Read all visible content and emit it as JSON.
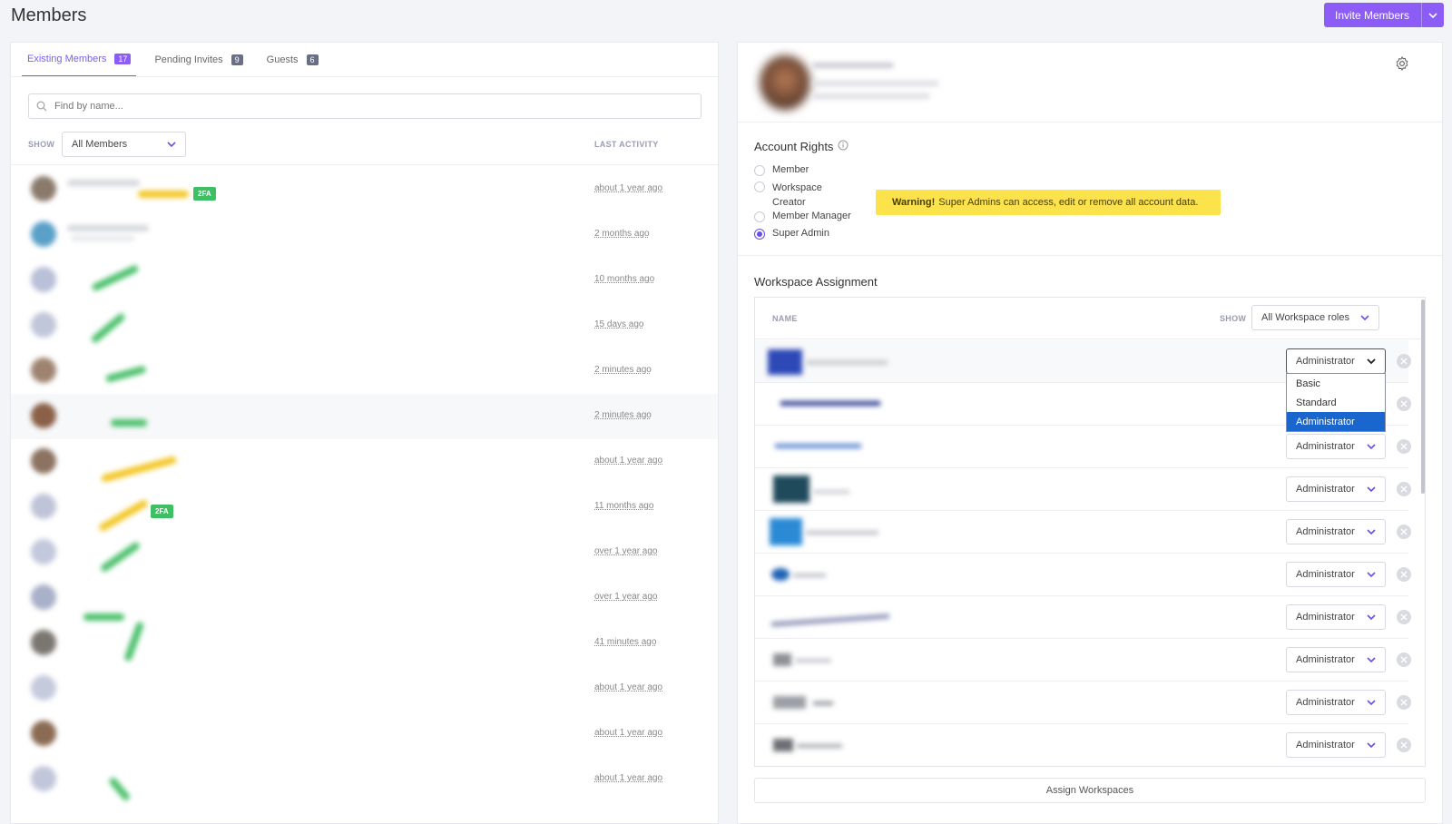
{
  "header": {
    "title": "Members",
    "invite_label": "Invite Members",
    "accent": "#8b5cf6"
  },
  "members_panel": {
    "tabs": [
      {
        "label": "Existing Members",
        "count": "17"
      },
      {
        "label": "Pending Invites",
        "count": "9"
      },
      {
        "label": "Guests",
        "count": "6"
      }
    ],
    "search_placeholder": "Find by name...",
    "show_label": "SHOW",
    "show_value": "All Members",
    "last_activity_label": "LAST ACTIVITY",
    "members": [
      {
        "activity": "about 1 year ago",
        "badge": "2FA"
      },
      {
        "activity": "2 months ago",
        "badge": ""
      },
      {
        "activity": "10 months ago",
        "badge": ""
      },
      {
        "activity": "15 days ago",
        "badge": ""
      },
      {
        "activity": "2 minutes ago",
        "badge": ""
      },
      {
        "activity": "2 minutes ago",
        "badge": ""
      },
      {
        "activity": "about 1 year ago",
        "badge": ""
      },
      {
        "activity": "11 months ago",
        "badge": "2FA"
      },
      {
        "activity": "over 1 year ago",
        "badge": ""
      },
      {
        "activity": "over 1 year ago",
        "badge": ""
      },
      {
        "activity": "41 minutes ago",
        "badge": ""
      },
      {
        "activity": "about 1 year ago",
        "badge": ""
      },
      {
        "activity": "about 1 year ago",
        "badge": ""
      },
      {
        "activity": "about 1 year ago",
        "badge": ""
      }
    ]
  },
  "detail_panel": {
    "account_rights_title": "Account Rights",
    "rights": [
      {
        "label": "Member",
        "selected": false
      },
      {
        "label": "Workspace Creator",
        "selected": false
      },
      {
        "label": "Member Manager",
        "selected": false
      },
      {
        "label": "Super Admin",
        "selected": true
      }
    ],
    "warning_strong": "Warning!",
    "warning_text": "Super Admins can access, edit or remove all account data.",
    "workspace_title": "Workspace Assignment",
    "name_label": "NAME",
    "show_label": "SHOW",
    "show_value": "All Workspace roles",
    "dropdown_options": [
      "Basic",
      "Standard",
      "Administrator"
    ],
    "dropdown_selected": "Administrator",
    "workspaces": [
      {
        "role": "Administrator"
      },
      {
        "role": "Administrator"
      },
      {
        "role": "Administrator"
      },
      {
        "role": "Administrator"
      },
      {
        "role": "Administrator"
      },
      {
        "role": "Administrator"
      },
      {
        "role": "Administrator"
      },
      {
        "role": "Administrator"
      },
      {
        "role": "Administrator"
      },
      {
        "role": "Administrator"
      }
    ],
    "assign_label": "Assign Workspaces"
  }
}
